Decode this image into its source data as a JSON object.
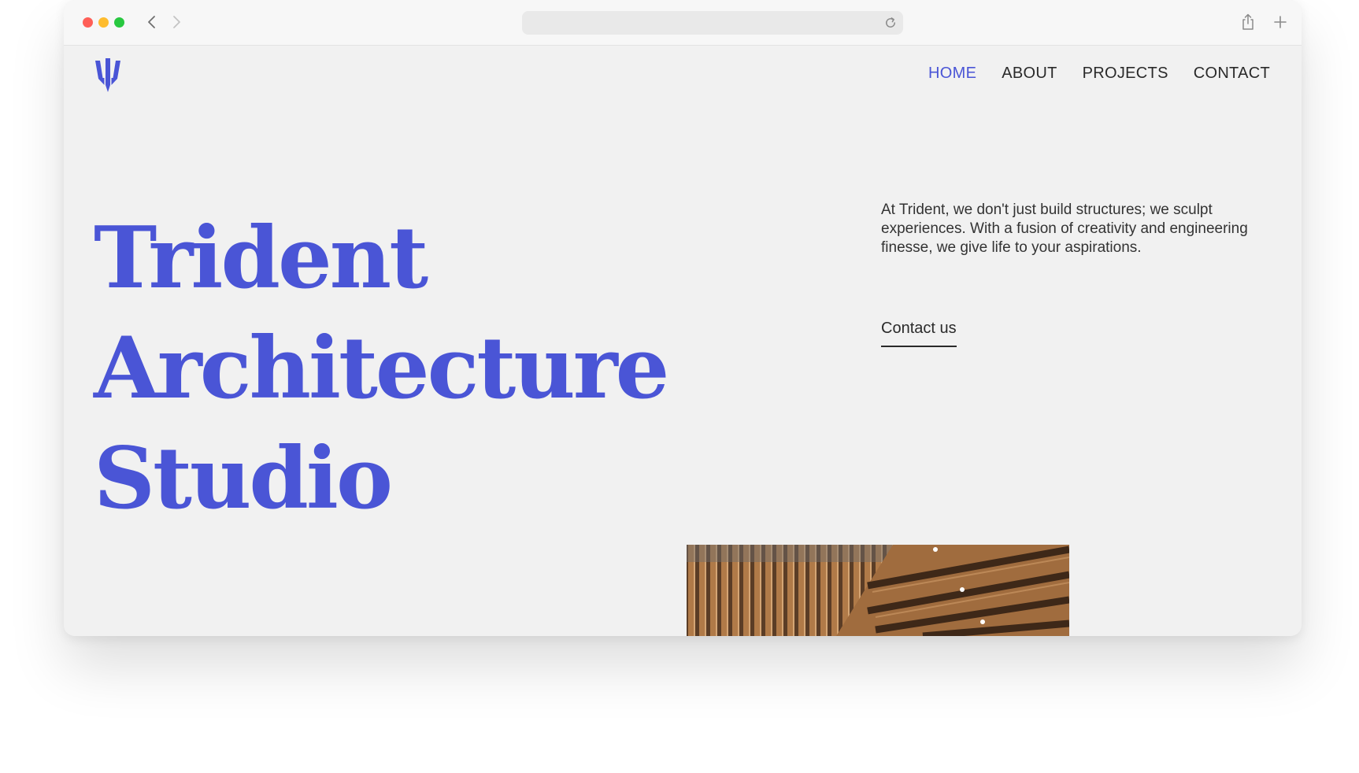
{
  "nav": {
    "items": [
      {
        "label": "HOME",
        "active": true
      },
      {
        "label": "ABOUT",
        "active": false
      },
      {
        "label": "PROJECTS",
        "active": false
      },
      {
        "label": "CONTACT",
        "active": false
      }
    ]
  },
  "hero": {
    "title_lines": [
      "Trident",
      "Architecture",
      "Studio"
    ],
    "description": "At Trident, we don't just build structures; we sculpt experiences. With a fusion of creativity and engineering finesse, we give life to your aspirations.",
    "cta_label": "Contact us"
  },
  "icons": {
    "logo": "trident-logo-icon",
    "back": "chevron-left-icon",
    "forward": "chevron-right-icon",
    "reload": "reload-icon",
    "share": "share-icon",
    "new_tab": "plus-icon"
  },
  "colors": {
    "accent": "#4a55d6",
    "text": "#2a2a2a",
    "page_background": "#f1f1f1",
    "traffic_red": "#ff5f57",
    "traffic_yellow": "#febc2e",
    "traffic_green": "#28c840"
  }
}
